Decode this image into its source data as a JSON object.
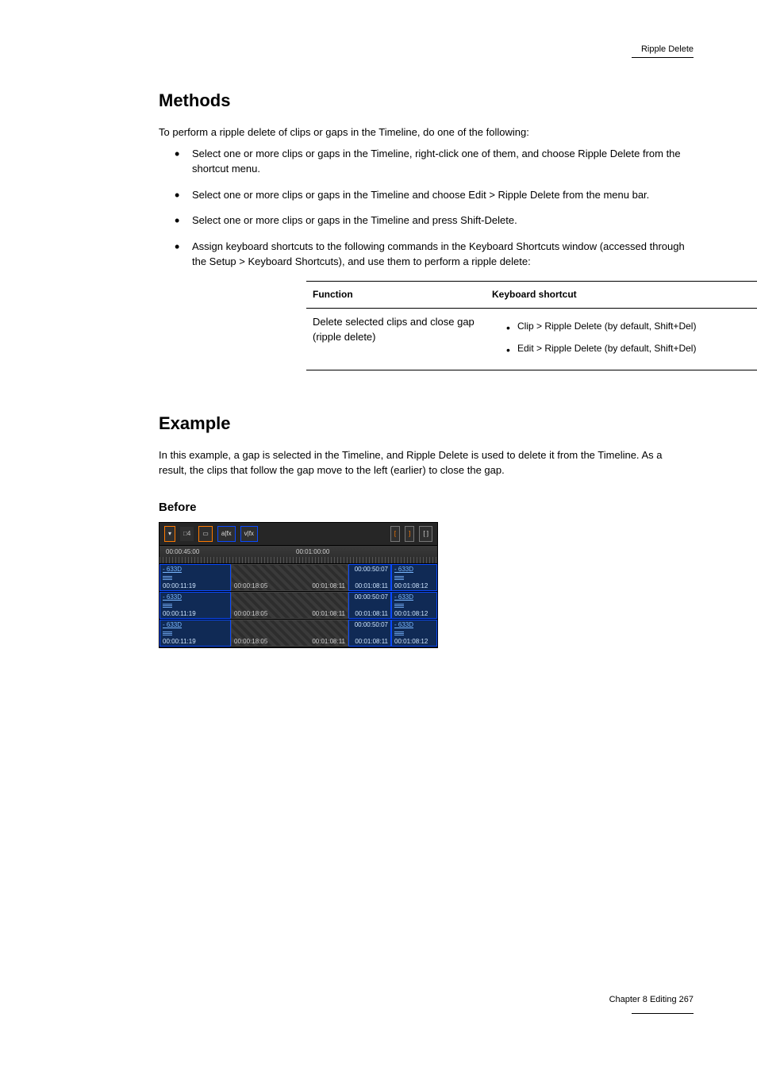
{
  "header": "Ripple Delete",
  "footer": "Chapter 8  Editing\n267",
  "sections": {
    "methods": {
      "title": "Methods",
      "intro": "To perform a ripple delete of clips or gaps in the Timeline, do one of the following:",
      "items": [
        "Select one or more clips or gaps in the Timeline, right-click one of them, and choose Ripple Delete from the shortcut menu.",
        "Select one or more clips or gaps in the Timeline and choose Edit > Ripple Delete from the menu bar.",
        "Select one or more clips or gaps in the Timeline and press Shift-Delete.",
        "Assign keyboard shortcuts to the following commands in the Keyboard Shortcuts window (accessed through the Setup > Keyboard Shortcuts), and use them to perform a ripple delete:",
        ""
      ],
      "table": {
        "headers": [
          "Function",
          "Keyboard shortcut"
        ],
        "rows": [
          {
            "function": "Delete selected clips and close gap (ripple delete)",
            "shortcuts": [
              "Clip > Ripple Delete (by default, Shift+Del)",
              "Edit > Ripple Delete (by default, Shift+Del)"
            ]
          }
        ]
      }
    },
    "example": {
      "title": "Example",
      "intro": "In this example, a gap is selected in the Timeline, and Ripple Delete is used to delete it from the Timeline. As a result, the clips that follow the gap move to the left (earlier) to close the gap.",
      "before_label": "Before"
    }
  },
  "shot": {
    "toolbar": {
      "cam": "□4",
      "afx": "a|fx",
      "vfx": "v|fx"
    },
    "ruler": [
      "00:00:45:00",
      "00:01:00:00"
    ],
    "clipA": {
      "name": "- 633D",
      "tc": "00:00:11:19"
    },
    "gap": {
      "inTc": "00:00:18:05",
      "outTc": "00:01:08:11"
    },
    "edge": {
      "top": "00:00:50:07",
      "bot": "00:01:08:11"
    },
    "clipB": {
      "name": "- 633D",
      "tc": "00:01:08:12"
    }
  }
}
